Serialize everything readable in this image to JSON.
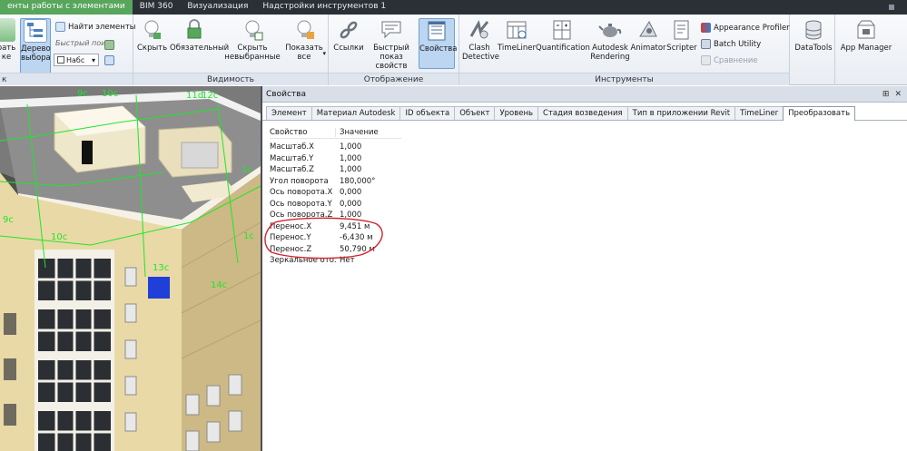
{
  "tabs": [
    {
      "label": "енты работы с элементами",
      "active": true
    },
    {
      "label": "BIM 360",
      "active": false
    },
    {
      "label": "Визуализация",
      "active": false
    },
    {
      "label": "Надстройки инструментов 1",
      "active": false
    }
  ],
  "ribbon": {
    "select": {
      "hide_label_a": "рать",
      "hide_label_b": "ке",
      "tree_label_a": "Дерево",
      "tree_label_b": "выбора",
      "find_items": "Найти элементы",
      "quick_find_placeholder": "Быстрый поиск",
      "set_combo": "Набс",
      "panel_title": "к"
    },
    "visibility": {
      "hide": "Скрыть",
      "required": "Обязательный",
      "hide_unselected_a": "Скрыть",
      "hide_unselected_b": "невыбранные",
      "show_all_a": "Показать",
      "show_all_b": "все",
      "panel_title": "Видимость"
    },
    "display": {
      "links": "Ссылки",
      "quick_props_a": "Быстрый",
      "quick_props_b": "показ свойств",
      "properties": "Свойства",
      "panel_title": "Отображение"
    },
    "tools": {
      "clash_a": "Clash",
      "clash_b": "Detective",
      "timeliner": "TimeLiner",
      "quantification": "Quantification",
      "rendering_a": "Autodesk",
      "rendering_b": "Rendering",
      "animator": "Animator",
      "scripter": "Scripter",
      "appearance_profiler": "Appearance Profiler",
      "batch_utility": "Batch Utility",
      "compare": "Сравнение",
      "panel_title": "Инструменты"
    },
    "datatools": "DataTools",
    "app_manager": "App Manager"
  },
  "viewport": {
    "grid_labels": [
      "9c",
      "10c",
      "11d",
      "12c",
      "9c",
      "10c",
      "13c",
      "14c",
      "1c",
      "1c"
    ]
  },
  "properties_window": {
    "title": "Свойства",
    "pin": "⊞",
    "close": "✕",
    "tabs": [
      {
        "label": "Элемент",
        "active": false
      },
      {
        "label": "Материал Autodesk",
        "active": false
      },
      {
        "label": "ID объекта",
        "active": false
      },
      {
        "label": "Объект",
        "active": false
      },
      {
        "label": "Уровень",
        "active": false
      },
      {
        "label": "Стадия возведения",
        "active": false
      },
      {
        "label": "Тип в приложении Revit",
        "active": false
      },
      {
        "label": "TimeLiner",
        "active": false
      },
      {
        "label": "Преобразовать",
        "active": true
      }
    ],
    "columns": {
      "property": "Свойство",
      "value": "Значение"
    },
    "rows": [
      {
        "name": "Масштаб.X",
        "value": "1,000"
      },
      {
        "name": "Масштаб.Y",
        "value": "1,000"
      },
      {
        "name": "Масштаб.Z",
        "value": "1,000"
      },
      {
        "name": "Угол поворота",
        "value": "180,000°"
      },
      {
        "name": "Ось поворота.X",
        "value": "0,000"
      },
      {
        "name": "Ось поворота.Y",
        "value": "0,000"
      },
      {
        "name": "Ось поворота.Z",
        "value": "1,000"
      },
      {
        "name": "Перенос.X",
        "value": "9,451 м"
      },
      {
        "name": "Перенос.Y",
        "value": "-6,430 м"
      },
      {
        "name": "Перенос.Z",
        "value": "50,790 м"
      },
      {
        "name": "Зеркальное ото...",
        "value": "Нет"
      }
    ]
  },
  "colors": {
    "active_tab": "#58a55c",
    "annotation": "#d0242a",
    "grid_lines": "#1ee62a",
    "selected_element": "#1e3fd8"
  }
}
